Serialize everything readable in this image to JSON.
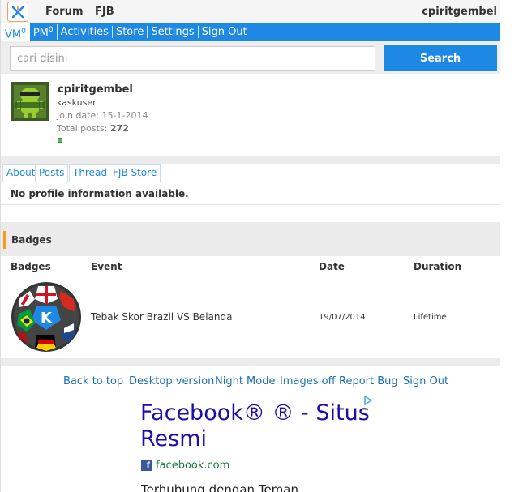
{
  "header": {
    "nav": [
      "Forum",
      "FJB"
    ],
    "username": "cpiritgembel"
  },
  "menu": {
    "items": [
      {
        "label": "VM",
        "sup": "0"
      },
      {
        "label": "PM",
        "sup": "0"
      },
      {
        "label": "Activities"
      },
      {
        "label": "Store"
      },
      {
        "label": "Settings"
      },
      {
        "label": "Sign Out"
      }
    ]
  },
  "search": {
    "placeholder": "cari disini",
    "button_label": "Search"
  },
  "profile": {
    "name": "cpiritgembel",
    "rank": "kaskuser",
    "join_label": "Join date: ",
    "join_date": "15-1-2014",
    "posts_label": "Total posts: ",
    "posts_count": "272",
    "status_color": "#5cb85c"
  },
  "tabs": [
    "About",
    "Posts",
    "Thread",
    "FJB Store"
  ],
  "about_text": "No profile information available.",
  "badges": {
    "section_title": "Badges",
    "columns": [
      "Badges",
      "Event",
      "Date",
      "Duration"
    ],
    "rows": [
      {
        "event": "Tebak Skor Brazil VS Belanda",
        "date": "19/07/2014",
        "duration": "Lifetime"
      }
    ]
  },
  "footer": {
    "links": [
      "Back to top",
      "Desktop version",
      "Night Mode",
      "Images off",
      "Report Bug",
      "Sign Out"
    ]
  },
  "ad": {
    "title": "Facebook® ® - Situs Resmi",
    "domain": "facebook.com",
    "description": "Terhubung dengan Teman"
  },
  "colors": {
    "brand_blue": "#1e88e5",
    "accent_orange": "#f59b1e"
  }
}
